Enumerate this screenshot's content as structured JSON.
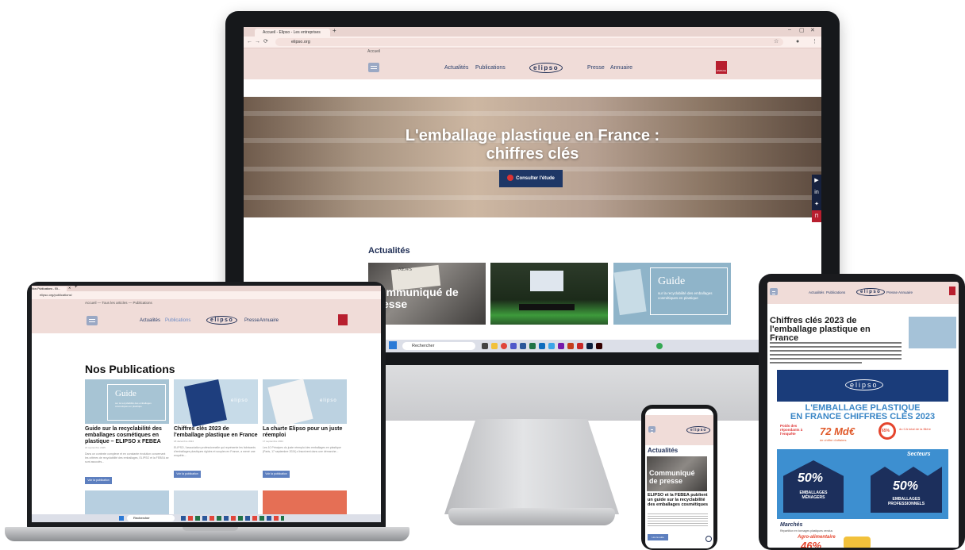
{
  "monitor": {
    "tab_title": "Accueil - Elipso - Les entreprises",
    "url": "elipso.org",
    "breadcrumb": "Accueil",
    "nav": {
      "actualites": "Actualités",
      "publications": "Publications",
      "presse": "Presse",
      "annuaire": "Annuaire",
      "logo": "elipso",
      "member_badge": "ESPACE ADH"
    },
    "hero": {
      "title_line1": "L'emballage plastique en France :",
      "title_line2": "chiffres clés",
      "button": "Consulter l'étude"
    },
    "social": [
      "youtube-icon",
      "linkedin-icon",
      "twitter-icon",
      "lock-icon"
    ],
    "section_title": "Actualités",
    "cards": [
      {
        "overlay": "Communiqué de presse",
        "badge": "NEWS"
      },
      {
        "overlay": ""
      },
      {
        "overlay": "Guide",
        "subtitle": "sur la recyclabilité des emballages cosmétiques en plastique"
      }
    ],
    "taskbar_search": "Rechercher"
  },
  "laptop": {
    "tab_title": "Nos Publications - Eli...",
    "url": "elipso.org/publications/",
    "breadcrumb": "Accueil  —  Tous les articles  —  Publications",
    "nav": {
      "actualites": "Actualités",
      "publications": "Publications",
      "presse": "Presse",
      "annuaire": "Annuaire",
      "logo": "elipso"
    },
    "page_title": "Nos Publications",
    "cards": [
      {
        "image_label": "Guide",
        "image_subtitle": "sur la recyclabilité des emballages cosmétiques en plastique",
        "title": "Guide sur la recyclabilité des emballages cosmétiques en plastique – ELIPSO x FEBEA",
        "date": "22 septembre 2025",
        "body": "Dans un contexte complexe et en constante évolution concernant les critères de recyclabilité des emballages, ELIPSO et la FEBEA se sont associés...",
        "button": "Voir la publication"
      },
      {
        "image_label": "elipso",
        "title": "Chiffres clés 2023 de l'emballage plastique en France",
        "date": "18 décembre 2024",
        "body": "ELIPSO, l'association professionnelle qui représente les fabricants d'emballages plastiques rigides et souples en France, a mené une enquête...",
        "button": "Voir la publication"
      },
      {
        "image_label": "elipso",
        "title": "La charte Elipso pour un juste réemploi",
        "date": "17 septembre 2024",
        "body": "Les 10 Principes du juste réemploi des emballages en plastique (Paris, 17 septembre 2024) s'inscrivent dans une démarche...",
        "button": "Voir la publication"
      }
    ],
    "taskbar_search": "Rechercher"
  },
  "tablet": {
    "nav": {
      "actualites": "Actualités",
      "publications": "Publications",
      "presse": "Presse",
      "annuaire": "Annuaire",
      "logo": "elipso"
    },
    "title": "Chiffres clés 2023 de l'emballage plastique en France",
    "date": "18 décembre 2024",
    "infographic": {
      "logo": "elipso",
      "headline_line1": "L'EMBALLAGE PLASTIQUE",
      "headline_line2": "EN FRANCE CHIFFRES CLÉS 2023",
      "poids": "Poids des répondants à l'enquête",
      "ca": "72 Md€",
      "ca_label": "de chiffre d'affaires",
      "pct65": "65%",
      "pct65_label": "du CA total de la filière",
      "secteurs": "Secteurs",
      "menagers_pct": "50%",
      "menagers_label": "EMBALLAGES MÉNAGERS",
      "pros_pct": "50%",
      "pros_label": "EMBALLAGES PROFESSIONNELS",
      "marches": "Marchés",
      "marches_sub": "Répartition en tonnages plastiques vendus",
      "agro": "Agro-alimentaire",
      "agro_pct": "46%"
    }
  },
  "phone": {
    "logo": "elipso",
    "section": "Actualités",
    "card_overlay": "Communiqué de presse",
    "article_title": "ELIPSO et la FEBEA publient un guide sur la recyclabilité des emballages cosmétiques",
    "button": "Lire la suite"
  },
  "colors": {
    "header_bg": "#f0dcd8",
    "navy": "#1f2e55",
    "accent_red": "#b81f2f",
    "button_blue": "#5d7fbf",
    "infographic_blue": "#3d8fd0"
  }
}
